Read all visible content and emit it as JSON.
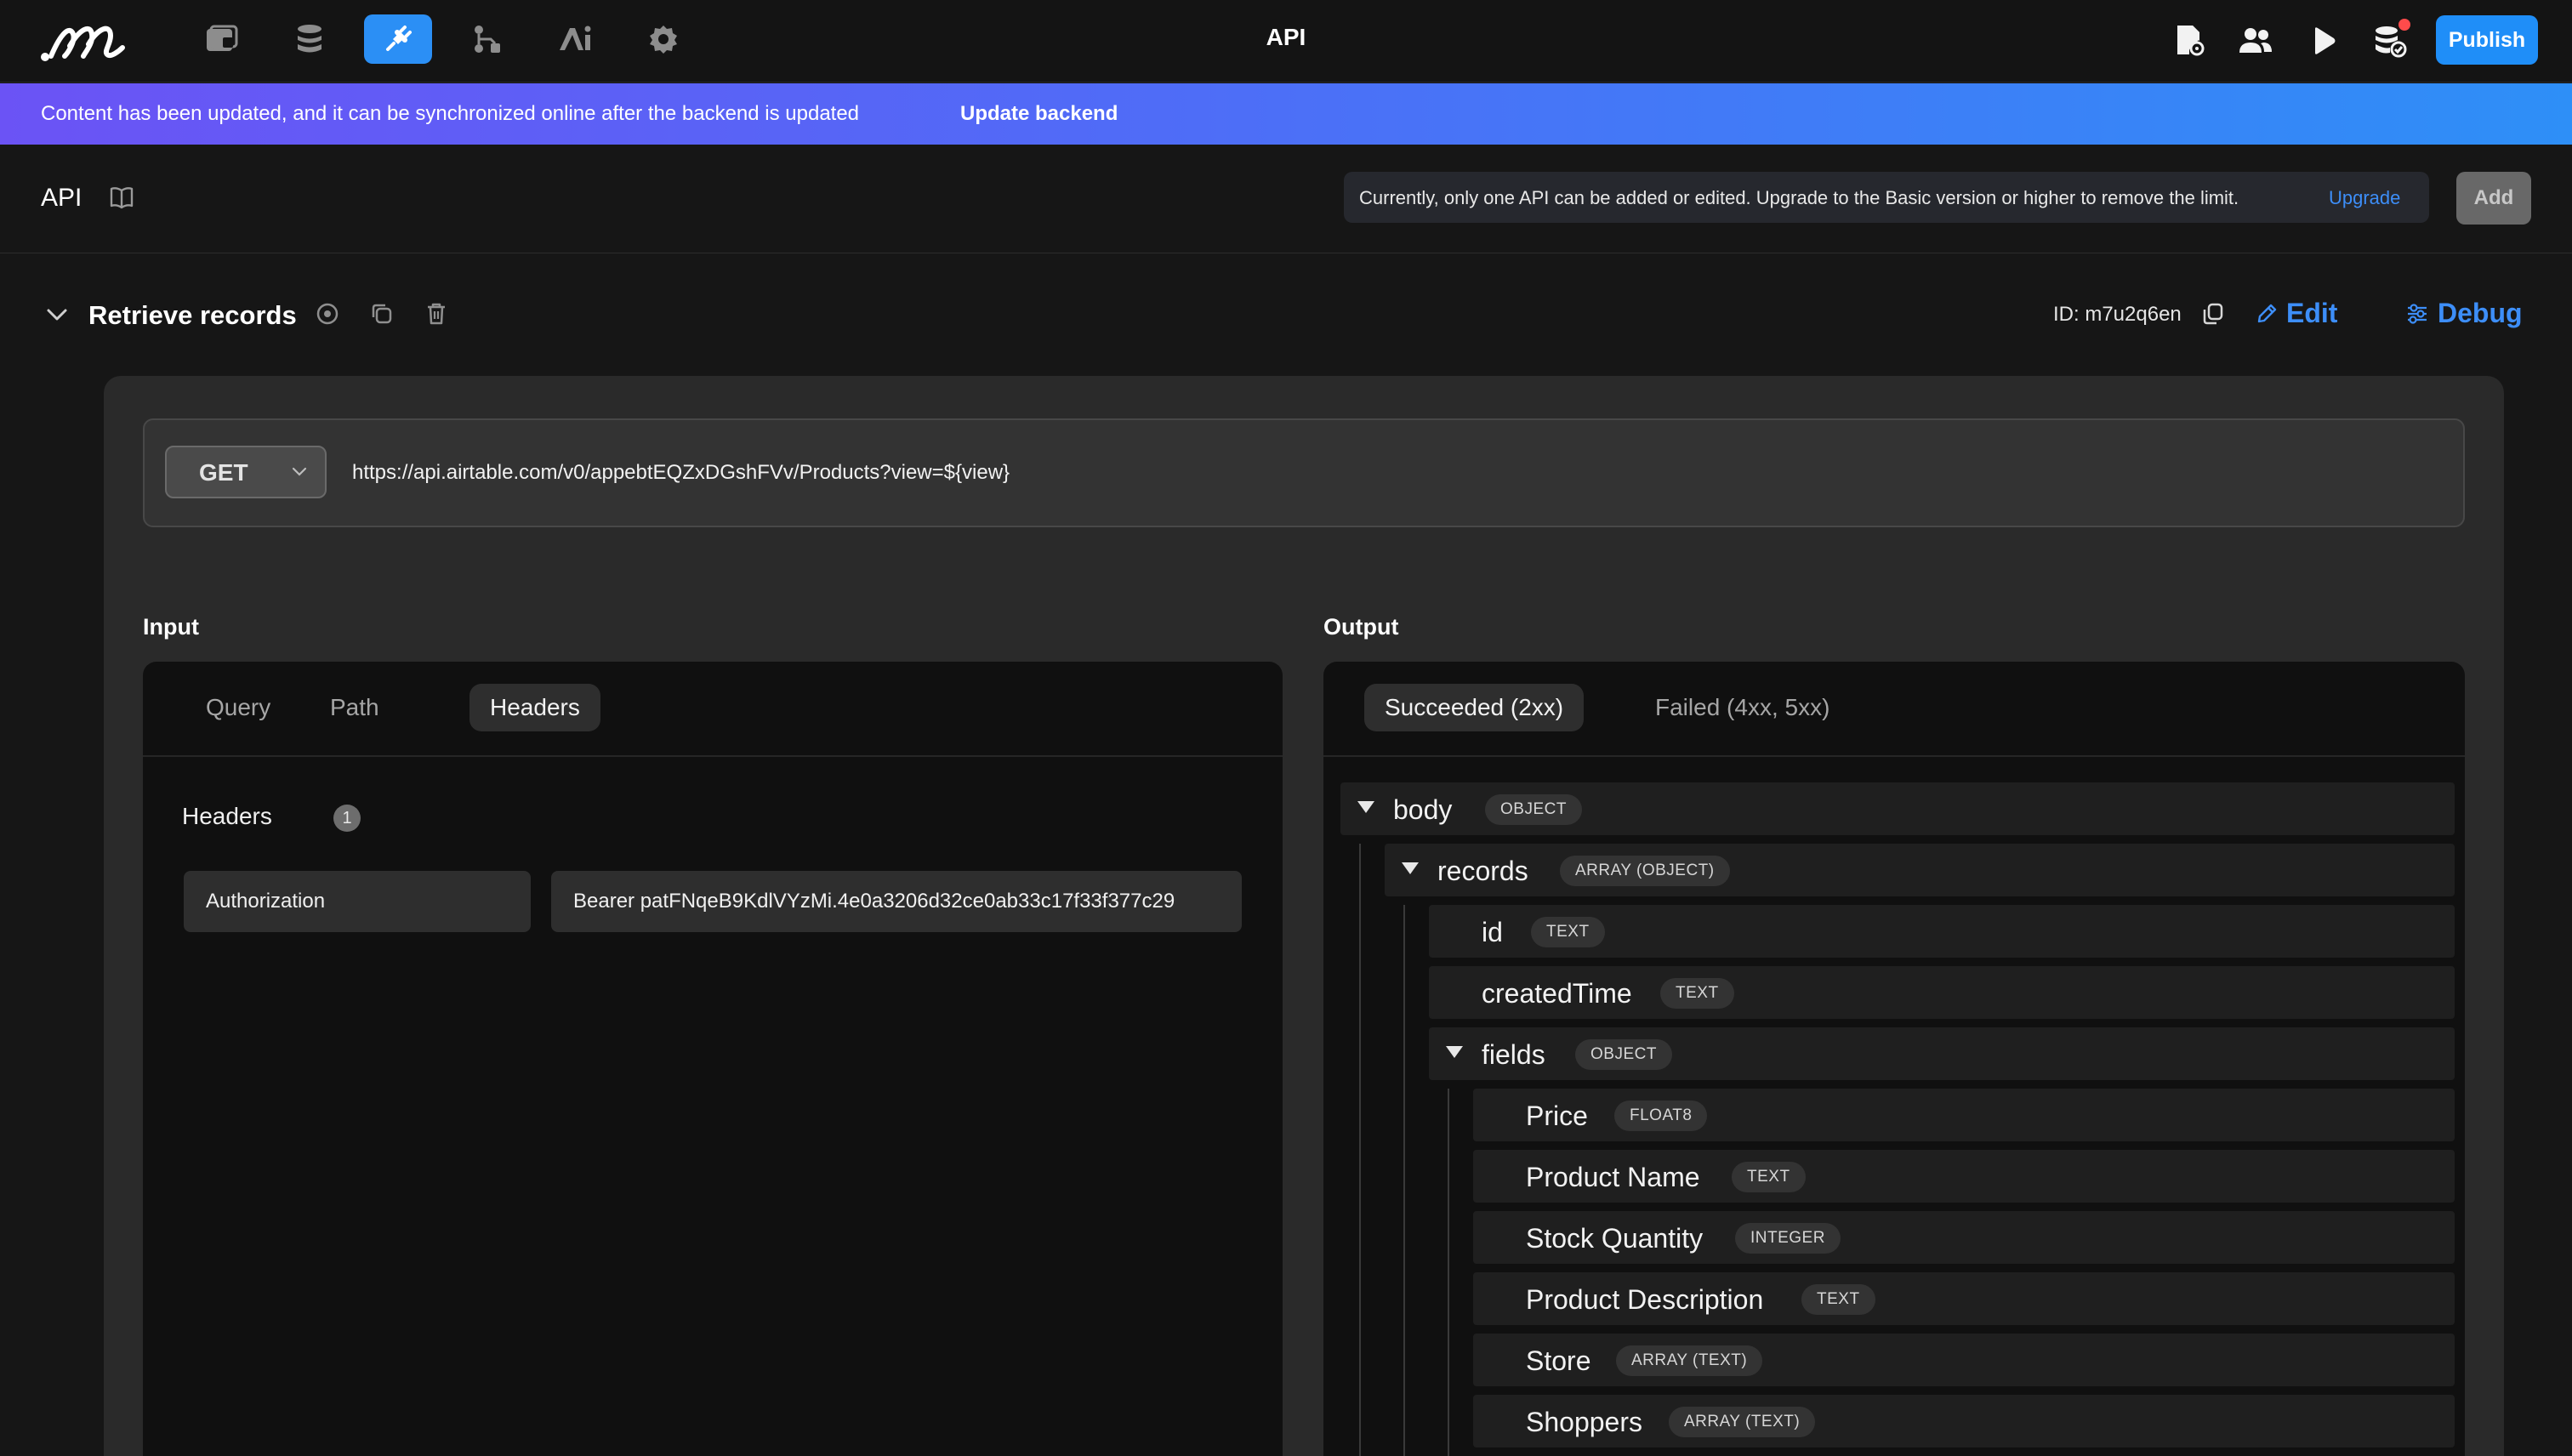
{
  "topbar": {
    "logo": "m-logo",
    "nav_icons": [
      "pages-icon",
      "database-icon",
      "api-plug-icon",
      "workflow-icon",
      "ai-icon",
      "settings-gear-icon"
    ],
    "active_nav": "api-plug-icon",
    "title": "API",
    "right_icons": [
      "document-settings-icon",
      "users-icon",
      "play-icon",
      "database-sync-icon"
    ],
    "publish_label": "Publish"
  },
  "banner": {
    "text": "Content has been updated, and it can be synchronized online after the backend is updated",
    "action_label": "Update backend"
  },
  "page_header": {
    "title": "API",
    "notice": "Currently, only one API can be added or edited. Upgrade to the Basic version or higher to remove the limit.",
    "upgrade_label": "Upgrade",
    "add_label": "Add"
  },
  "api": {
    "name": "Retrieve records",
    "id_text": "ID: m7u2q6en",
    "edit_label": "Edit",
    "debug_label": "Debug",
    "method": "GET",
    "url": "https://api.airtable.com/v0/appebtEQZxDGshFVv/Products?view=${view}"
  },
  "input": {
    "label": "Input",
    "tabs": [
      "Query",
      "Path",
      "Headers"
    ],
    "active_tab": "Headers",
    "headers_title": "Headers",
    "headers_count": "1",
    "header_key": "Authorization",
    "header_value": "Bearer patFNqeB9KdlVYzMi.4e0a3206d32ce0ab33c17f33f377c29"
  },
  "output": {
    "label": "Output",
    "tabs": [
      "Succeeded (2xx)",
      "Failed (4xx, 5xx)"
    ],
    "active_tab": "Succeeded (2xx)",
    "tree": [
      {
        "name": "body",
        "type": "OBJECT"
      },
      {
        "name": "records",
        "type": "ARRAY (OBJECT)"
      },
      {
        "name": "id",
        "type": "TEXT"
      },
      {
        "name": "createdTime",
        "type": "TEXT"
      },
      {
        "name": "fields",
        "type": "OBJECT"
      },
      {
        "name": "Price",
        "type": "FLOAT8"
      },
      {
        "name": "Product Name",
        "type": "TEXT"
      },
      {
        "name": "Stock Quantity",
        "type": "INTEGER"
      },
      {
        "name": "Product Description",
        "type": "TEXT"
      },
      {
        "name": "Store",
        "type": "ARRAY (TEXT)"
      },
      {
        "name": "Shoppers",
        "type": "ARRAY (TEXT)"
      }
    ]
  },
  "colors": {
    "accent": "#2b8ff5",
    "link": "#3d8ef8",
    "banner_start": "#6b53f5",
    "banner_end": "#2e8ff7",
    "notification_dot": "#ff4b4b"
  }
}
